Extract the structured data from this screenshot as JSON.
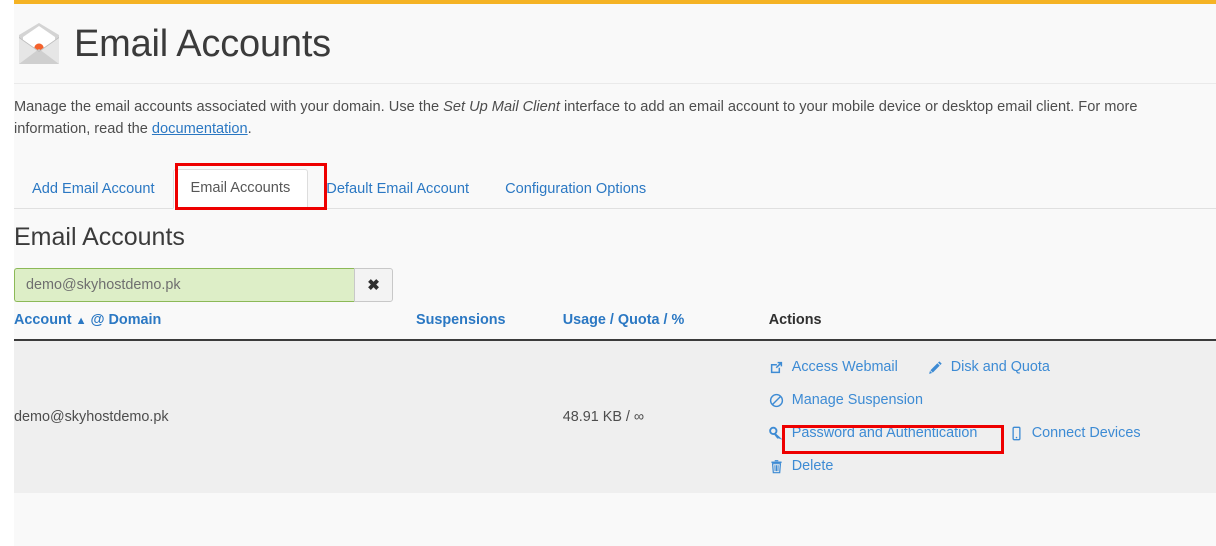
{
  "page": {
    "title": "Email Accounts",
    "icon": "email-account-icon",
    "accent_color": "#f5b324",
    "link_color": "#2b78c3"
  },
  "description": {
    "part1": "Manage the email accounts associated with your domain. Use the ",
    "emphasis": "Set Up Mail Client",
    "part2": " interface to add an email account to your mobile device or desktop email client. For more information, read the ",
    "link_text": "documentation",
    "part3": "."
  },
  "tabs": [
    {
      "label": "Add Email Account",
      "active": false
    },
    {
      "label": "Email Accounts",
      "active": true
    },
    {
      "label": "Default Email Account",
      "active": false
    },
    {
      "label": "Configuration Options",
      "active": false
    }
  ],
  "section": {
    "heading": "Email Accounts"
  },
  "search": {
    "value": "demo@skyhostdemo.pk",
    "placeholder": "demo@skyhostdemo.pk",
    "clear_icon": "close-x-icon",
    "clear_label": "✖"
  },
  "table": {
    "headers": {
      "account": "Account",
      "sort_arrow": "▲",
      "at": "@",
      "domain": "Domain",
      "suspensions": "Suspensions",
      "usage": "Usage",
      "sep1": "/",
      "quota": "Quota",
      "sep2": "/",
      "percent": "%",
      "actions": "Actions"
    },
    "rows": [
      {
        "account": "demo@skyhostdemo.pk",
        "suspensions": "",
        "usage": "48.91 KB / ∞",
        "actions": [
          {
            "label": "Access Webmail",
            "icon": "external-link-icon"
          },
          {
            "label": "Disk and Quota",
            "icon": "pencil-icon"
          },
          {
            "label": "Manage Suspension",
            "icon": "ban-icon"
          },
          {
            "label": "Password and Authentication",
            "icon": "key-icon"
          },
          {
            "label": "Connect Devices",
            "icon": "mobile-phone-icon"
          },
          {
            "label": "Delete",
            "icon": "trash-icon"
          }
        ]
      }
    ]
  },
  "annotations": [
    {
      "name": "tab-highlight",
      "color": "#ee0000",
      "target": "Email Accounts tab"
    },
    {
      "name": "password-highlight",
      "color": "#ee0000",
      "target": "Password and Authentication"
    }
  ]
}
